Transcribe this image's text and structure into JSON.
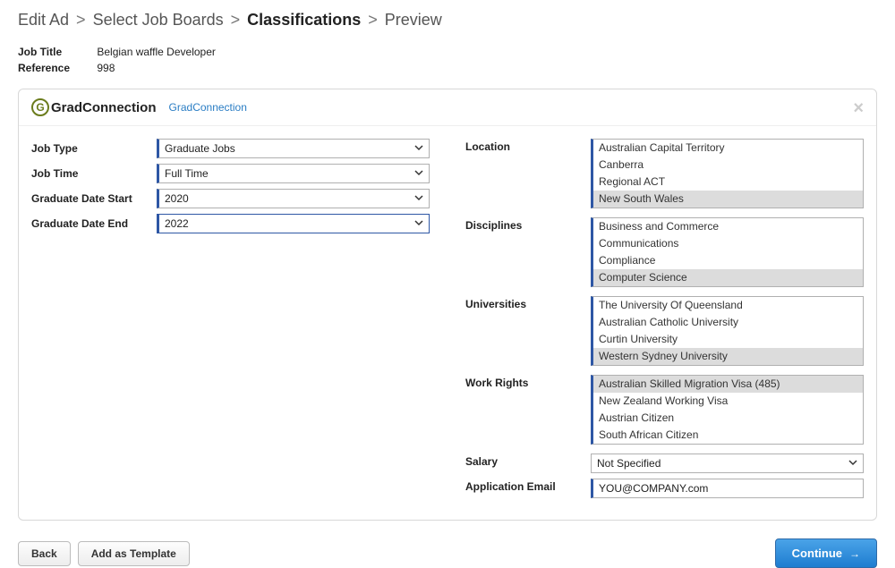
{
  "breadcrumb": {
    "items": [
      {
        "label": "Edit Ad"
      },
      {
        "label": "Select Job Boards"
      },
      {
        "label": "Classifications"
      },
      {
        "label": "Preview"
      }
    ],
    "current_index": 2,
    "sep": ">"
  },
  "meta": {
    "job_title_label": "Job Title",
    "job_title_value": "Belgian waffle Developer",
    "reference_label": "Reference",
    "reference_value": "998"
  },
  "panel": {
    "logo_text": "GradConnection",
    "logo_letter": "G",
    "link_text": "GradConnection",
    "close": "×"
  },
  "left": {
    "job_type": {
      "label": "Job Type",
      "value": "Graduate Jobs"
    },
    "job_time": {
      "label": "Job Time",
      "value": "Full Time"
    },
    "grad_start": {
      "label": "Graduate Date Start",
      "value": "2020"
    },
    "grad_end": {
      "label": "Graduate Date End",
      "value": "2022"
    }
  },
  "right": {
    "location": {
      "label": "Location",
      "options": [
        {
          "text": "Australian Capital Territory",
          "selected": false
        },
        {
          "text": "Canberra",
          "selected": false
        },
        {
          "text": "Regional ACT",
          "selected": false
        },
        {
          "text": "New South Wales",
          "selected": true
        }
      ]
    },
    "disciplines": {
      "label": "Disciplines",
      "options": [
        {
          "text": "Business and Commerce",
          "selected": false
        },
        {
          "text": "Communications",
          "selected": false
        },
        {
          "text": "Compliance",
          "selected": false
        },
        {
          "text": "Computer Science",
          "selected": true
        }
      ]
    },
    "universities": {
      "label": "Universities",
      "options": [
        {
          "text": "The University Of Queensland",
          "selected": false
        },
        {
          "text": "Australian Catholic University",
          "selected": false
        },
        {
          "text": "Curtin University",
          "selected": false
        },
        {
          "text": "Western Sydney University",
          "selected": true
        }
      ]
    },
    "work_rights": {
      "label": "Work Rights",
      "options": [
        {
          "text": "Australian Skilled Migration Visa (485)",
          "selected": true
        },
        {
          "text": "New Zealand Working Visa",
          "selected": false
        },
        {
          "text": "Austrian Citizen",
          "selected": false
        },
        {
          "text": "South African Citizen",
          "selected": false
        }
      ]
    },
    "salary": {
      "label": "Salary",
      "value": "Not Specified"
    },
    "app_email": {
      "label": "Application Email",
      "value": "YOU@COMPANY.com"
    }
  },
  "footer": {
    "back": "Back",
    "add_template": "Add as Template",
    "continue": "Continue",
    "arrow": "→"
  }
}
